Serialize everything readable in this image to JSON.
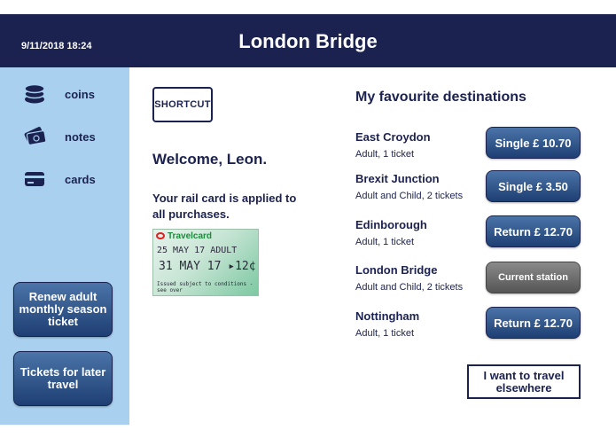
{
  "header": {
    "datetime": "9/11/2018 18:24",
    "station": "London Bridge"
  },
  "sidebar": {
    "payment_methods": [
      {
        "label": "coins",
        "icon": "coins-icon"
      },
      {
        "label": "notes",
        "icon": "notes-icon"
      },
      {
        "label": "cards",
        "icon": "card-icon"
      }
    ],
    "buttons": [
      {
        "label": "Renew adult monthly season ticket"
      },
      {
        "label": "Tickets for later travel"
      }
    ]
  },
  "main": {
    "shortcut_label": "SHORTCUT",
    "welcome": "Welcome, Leon.",
    "railcard_text": "Your rail card is applied to all purchases.",
    "travelcard": {
      "brand": "Travelcard",
      "line1": "25 MAY 17  ADULT",
      "line2": "31 MAY 17   ▸12¢",
      "line3": "Issued subject to conditions - see over"
    }
  },
  "favourites": {
    "title": "My favourite destinations",
    "destinations": [
      {
        "name": "East Croydon",
        "detail": "Adult, 1 ticket",
        "button": "Single £ 10.70",
        "current": false
      },
      {
        "name": "Brexit Junction",
        "detail": "Adult and Child, 2 tickets",
        "button": "Single £ 3.50",
        "current": false
      },
      {
        "name": "Edinborough",
        "detail": "Adult, 1 ticket",
        "button": "Return £ 12.70",
        "current": false
      },
      {
        "name": "London Bridge",
        "detail": "Adult and Child, 2 tickets",
        "button": "Current station",
        "current": true
      },
      {
        "name": "Nottingham",
        "detail": "Adult, 1 ticket",
        "button": "Return £ 12.70",
        "current": false
      }
    ],
    "elsewhere_button": "I want to travel elsewhere"
  },
  "colors": {
    "header_bg": "#1b2250",
    "sidebar_bg": "#a9d1ef",
    "button_gradient_top": "#4b74a8",
    "button_gradient_bottom": "#1e3f73",
    "current_button": "#6f6f6f"
  }
}
